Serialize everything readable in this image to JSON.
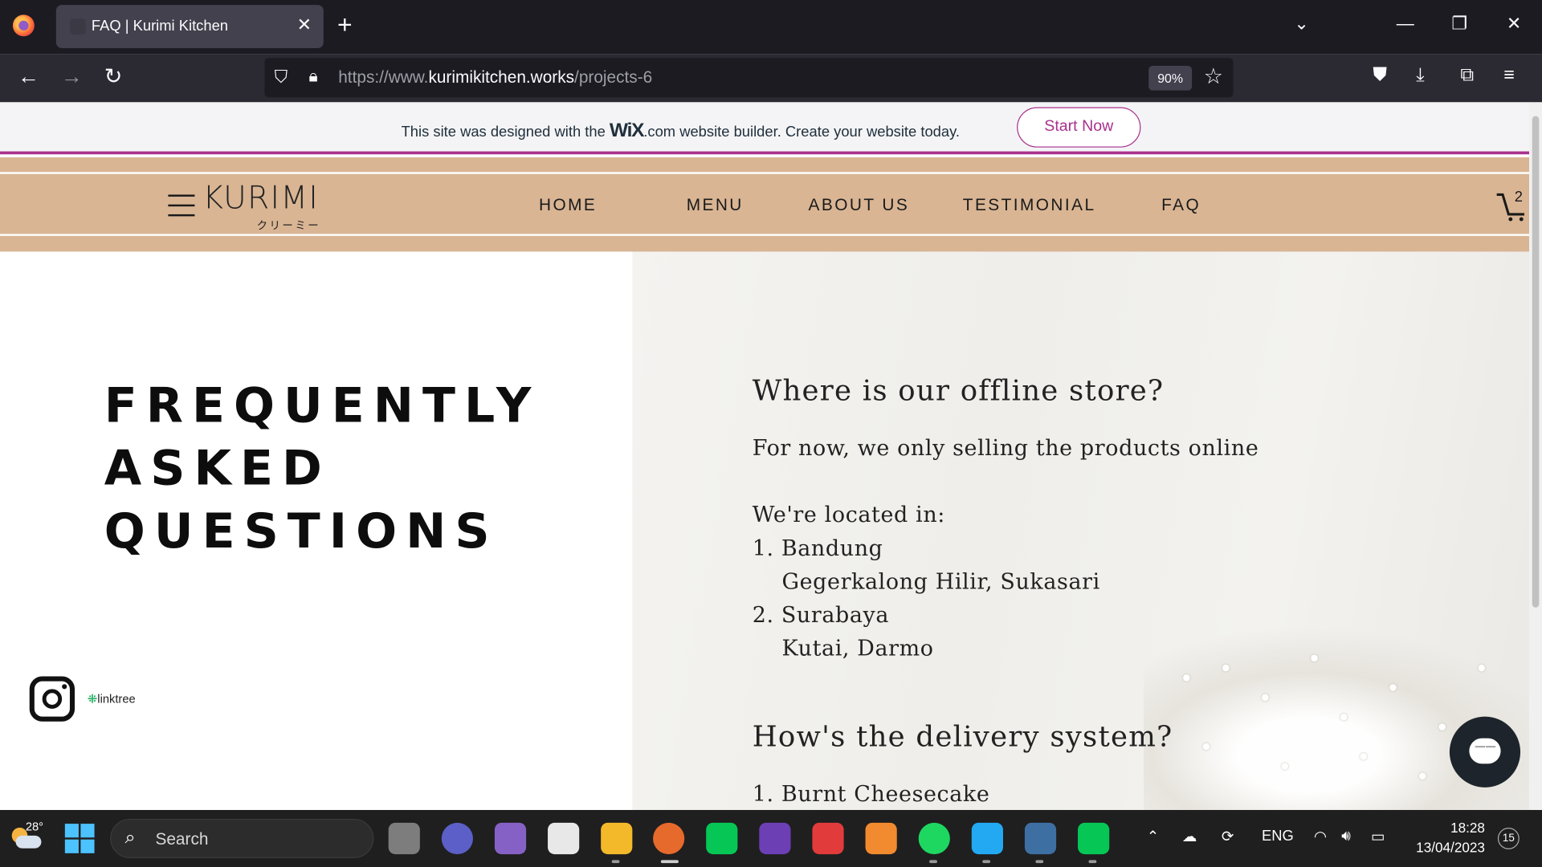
{
  "browser": {
    "tab_title": "FAQ | Kurimi Kitchen",
    "url_prefix": "https://www.",
    "url_domain": "kurimikitchen.works",
    "url_path": "/projects-6",
    "zoom": "90%"
  },
  "wix_banner": {
    "message_before": "This site was designed with the",
    "logo": "WiX",
    "message_after": ".com website builder. Create your website today.",
    "button": "Start Now"
  },
  "site": {
    "brand": "KURIMI",
    "brand_sub": "クリーミー",
    "nav": [
      "HOME",
      "MENU",
      "ABOUT US",
      "TESTIMONIAL",
      "FAQ"
    ],
    "cart_count": "2",
    "faq_title_lines": [
      "FREQUENTLY",
      "ASKED",
      "QUESTIONS"
    ],
    "linktree": "linktree"
  },
  "faq": {
    "q1": "Where is our offline store?",
    "a1_line1": "For now, we only selling the products online",
    "a1_line2": "We're located in:",
    "a1_line3": "1. Bandung",
    "a1_line4": "Gegerkalong Hilir, Sukasari",
    "a1_line5": "2. Surabaya",
    "a1_line6": "Kutai, Darmo",
    "q2": "How's the delivery system?",
    "a2_line1": "1. Burnt Cheesecake"
  },
  "taskbar": {
    "temperature": "28°",
    "search_label": "Search",
    "language": "ENG",
    "time": "18:28",
    "date": "13/04/2023",
    "notifications": "15"
  },
  "colors": {
    "header_bg": "#d9b594",
    "wix_accent": "#a8318c",
    "chat_button": "#1d242b"
  }
}
